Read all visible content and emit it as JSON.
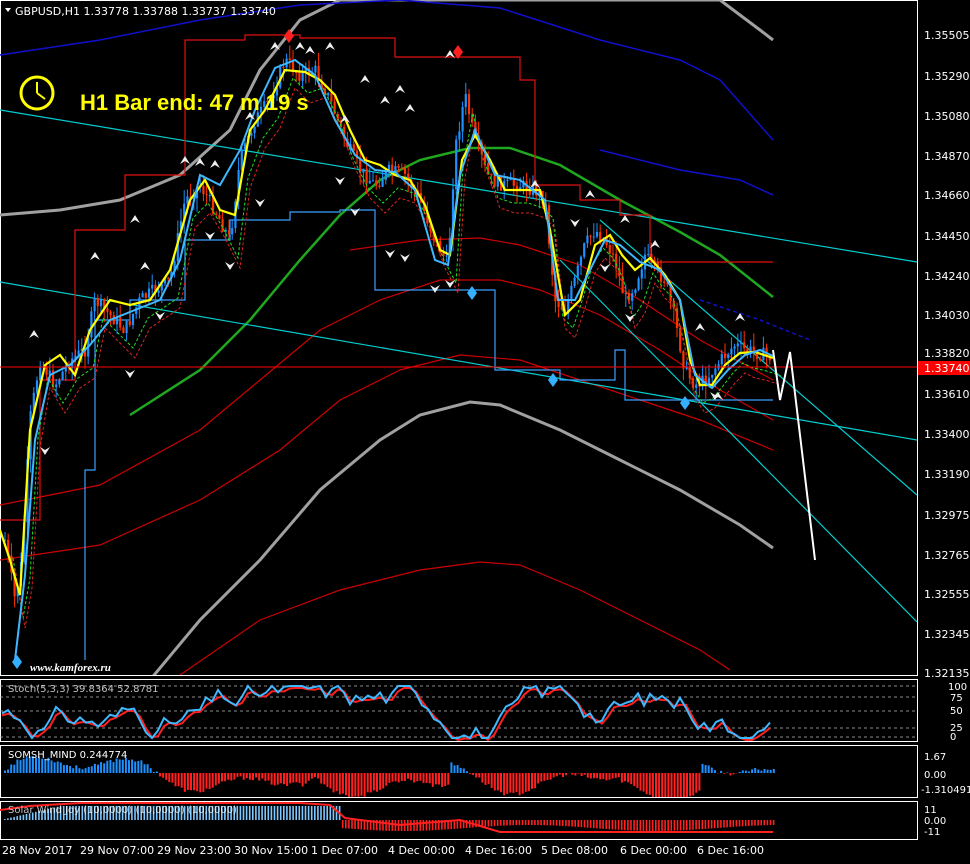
{
  "header": {
    "symbol_line": "GBPUSD,H1  1.33778 1.33788 1.33737 1.33740"
  },
  "timer": {
    "label": "H1 Bar end: 47 m 19 s",
    "icon": "clock-icon",
    "color": "#FFFF00"
  },
  "watermark": "www.kamforex.ru",
  "price_axis": {
    "labels": [
      "1.35505",
      "1.35290",
      "1.35080",
      "1.34870",
      "1.34660",
      "1.34450",
      "1.34240",
      "1.34030",
      "1.33820",
      "1.33610",
      "1.33400",
      "1.33190",
      "1.32975",
      "1.32765",
      "1.32555",
      "1.32345",
      "1.32135"
    ],
    "current": "1.33740",
    "current_color": "#FF0000"
  },
  "time_axis": {
    "labels": [
      "28 Nov 2017",
      "29 Nov 07:00",
      "29 Nov 23:00",
      "30 Nov 15:00",
      "1 Dec 07:00",
      "4 Dec 00:00",
      "4 Dec 16:00",
      "5 Dec 08:00",
      "6 Dec 00:00",
      "6 Dec 16:00"
    ]
  },
  "subwindows": [
    {
      "id": "stoch",
      "title": "Stoch(5,3,3) 39.8364 52.8781",
      "scale": [
        "100",
        "75",
        "50",
        "25",
        "0"
      ],
      "colors": {
        "main": "#1E90FF",
        "signal": "#FF0000"
      }
    },
    {
      "id": "hist1",
      "title": "SOMSH_MIND  0.244774",
      "scale": [
        "1.67",
        "0.00",
        "-1.310491"
      ],
      "colors": {
        "up": "#1E90FF",
        "down": "#FF0000"
      }
    },
    {
      "id": "hist2",
      "title": "Solar Wind Joy (10,0000) (10,0000) (10,0000)",
      "scale": [
        "11",
        "0.00",
        "-11"
      ],
      "colors": {
        "up": "#7EC8FF",
        "down": "#FF0000"
      }
    }
  ],
  "colors": {
    "bull": "#1E90FF",
    "bear": "#FF3300",
    "yellow": "#FFFF00",
    "cyan": "#00CED1",
    "band_red": "#CC0000",
    "grey": "#A0A0A0",
    "green": "#1FA81F",
    "navy": "#1010CC"
  }
}
